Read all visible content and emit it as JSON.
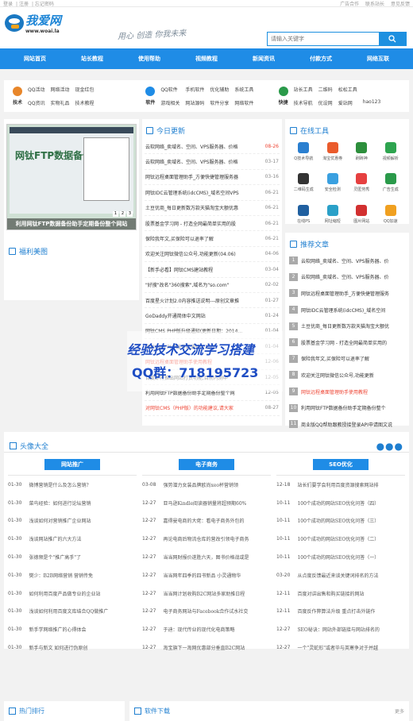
{
  "topbar": {
    "left": [
      "登录",
      "注册",
      "忘记密码"
    ],
    "right": [
      "广告合作",
      "联系站长",
      "意见反馈"
    ]
  },
  "logo": {
    "main": "我爱网",
    "sub": "www.woai.la"
  },
  "slogan": "用心 创造 你我未来",
  "search": {
    "placeholder": "请输入关键字"
  },
  "nav": [
    "网站首页",
    "站长教程",
    "使用帮助",
    "视频教程",
    "新闻资讯",
    "付款方式",
    "网络互联"
  ],
  "categories": [
    {
      "name": "技术",
      "color": "#e8862a",
      "links": [
        "QQ活动",
        "网络活动",
        "现金红包",
        "QQ资讯",
        "实物礼品",
        "技术教程"
      ]
    },
    {
      "name": "软件",
      "color": "#1f8ce6",
      "links": [
        "QQ软件",
        "手机软件",
        "优化辅助",
        "系统工具",
        "游戏相关",
        "网站源码",
        "软件分享",
        "网络软件"
      ]
    },
    {
      "name": "快捷",
      "color": "#2a9a4a",
      "links": [
        "站长工具",
        "二维码",
        "松松工具",
        "技术导航",
        "优设网",
        "爱站网",
        "优媒体",
        "唐网首页",
        "hao123"
      ]
    }
  ],
  "slider": {
    "caption": "利用网钛FTP数据备份助手定期备份整个网站",
    "big": "网钛FTP数据备份助手",
    "pages": [
      "1",
      "2",
      "3"
    ]
  },
  "sections": {
    "today": "今日更新",
    "tools": "在线工具",
    "beauty": "福利美图",
    "recommend": "推荐文章",
    "avatar": "头像大全",
    "hot": "热门排行",
    "download": "软件下载",
    "more": "更多"
  },
  "news": [
    {
      "t": "云软网络_卖域名、空间、VPS服务器、价格",
      "d": "08-26",
      "red": true
    },
    {
      "t": "云软网络_卖域名、空间、VPS服务器、价格",
      "d": "03-17"
    },
    {
      "t": "网钛远程桌面管理助手_方便快捷管理服务器",
      "d": "03-16"
    },
    {
      "t": "网钛IDC云管理系统(idcCMS)_域名空间VPS",
      "d": "06-21"
    },
    {
      "t": "土豆优商_每日更新数万款天猫淘宝大额优惠",
      "d": "06-21"
    },
    {
      "t": "股票基金学习网 - 打造全网最简单实用的股",
      "d": "06-21"
    },
    {
      "t": "保险我年文,买保险可以退率了解",
      "d": "06-21"
    },
    {
      "t": "欢迎关注网钛微信公众号,功能更新(04.06)",
      "d": "04-06"
    },
    {
      "t": "【新手必看】网钛CMS建站教程",
      "d": "03-04"
    },
    {
      "t": "\"好搜\"改名\"360搜索\",域名为\"so.com\"",
      "d": "02-02"
    },
    {
      "t": "百度星火计划2.0内容推送说明---原创文章推",
      "d": "01-27"
    },
    {
      "t": "GoDaddy开通简体中文网站",
      "d": "01-24"
    },
    {
      "t": "网钛CMS PHP版升级通知(更新日期：2014...",
      "d": "01-04"
    },
    {
      "t": "网钛CMS PHP版升级通知(V3.1)",
      "d": "01-04"
    },
    {
      "t": "网钛远程桌面管理助手使用教程",
      "d": "12-06",
      "red2": true
    },
    {
      "t": "百度即将推出网站打赏功能,目前内测中",
      "d": "12-05"
    },
    {
      "t": "利用网钛FTP数据备份助手定期备份整个网",
      "d": "12-05"
    },
    {
      "t": "对网钛CMS（PHP版）的功能建议,请大家",
      "d": "08-27",
      "red2": true
    }
  ],
  "tools": [
    {
      "n": "Q技术导航",
      "c": "#2a7fd0"
    },
    {
      "n": "淘宝优惠券",
      "c": "#ea5b2c"
    },
    {
      "n": "刷砖神",
      "c": "#2d8f3c"
    },
    {
      "n": "视频解析",
      "c": "#2ea44f"
    },
    {
      "n": "二维码生成",
      "c": "#333333"
    },
    {
      "n": "安全检测",
      "c": "#3aa0e0"
    },
    {
      "n": "灵匿劳秀",
      "c": "#e64040"
    },
    {
      "n": "广告生成",
      "c": "#2a9a4a"
    },
    {
      "n": "在线PS",
      "c": "#2060a0"
    },
    {
      "n": "网址缩短",
      "c": "#2aa0c8"
    },
    {
      "n": "图片网站",
      "c": "#d23030"
    },
    {
      "n": "QQ加速",
      "c": "#f0a020"
    }
  ],
  "recommend": [
    {
      "n": "1",
      "t": "云软网络_卖域名、空间、VPS服务器、价"
    },
    {
      "n": "2",
      "t": "云软网络_卖域名、空间、VPS服务器、价"
    },
    {
      "n": "3",
      "t": "网钛远程桌面管理助手_方便快捷管理服务"
    },
    {
      "n": "4",
      "t": "网钛IDC云管理系统(idcCMS)_域名空间"
    },
    {
      "n": "5",
      "t": "土豆优商_每日更新数万款天猫淘宝大额优"
    },
    {
      "n": "6",
      "t": "股票基金学习网 - 打造全网最简单实用的"
    },
    {
      "n": "7",
      "t": "保险我年文,买保险可以退率了解"
    },
    {
      "n": "8",
      "t": "欢迎关注网钛微信公众号,功能更新"
    },
    {
      "n": "9",
      "t": "网钛远程桌面管理助手使用教程",
      "hl": true
    },
    {
      "n": "10",
      "t": "利用网钛FTP数据备份助手定期备份整个"
    },
    {
      "n": "11",
      "t": "商业版QQ帮助跟教授接登录API申请图文说"
    }
  ],
  "watermark": {
    "line1": "经验技术交流学习搭建",
    "line2": "QQ群：718195723"
  },
  "art_cols": [
    {
      "title": "网站推广",
      "items": [
        {
          "d": "01-30",
          "t": "微博营销是什么及怎么营销?"
        },
        {
          "d": "01-30",
          "t": "菜鸟经验：如何进行论坛营销"
        },
        {
          "d": "01-30",
          "t": "浅谈如何对营销推广企业网站"
        },
        {
          "d": "01-30",
          "t": "浅谈网站推广的六大方法"
        },
        {
          "d": "01-30",
          "t": "张德频是个\"推广高手\"了"
        },
        {
          "d": "01-30",
          "t": "樊少：B2B网络营销 营销传免"
        },
        {
          "d": "01-30",
          "t": "如何利用百度产品做专业的企业站"
        },
        {
          "d": "01-30",
          "t": "浅谈如何利用百度文库结合QQ做推广"
        },
        {
          "d": "01-30",
          "t": "新手学网络推广的心得体会"
        },
        {
          "d": "01-30",
          "t": "新手与新文 如何进行伪原创"
        }
      ]
    },
    {
      "title": "电子商务",
      "items": [
        {
          "d": "03-08",
          "t": "强势潜力女装品牌欧尚xeo杯营销领"
        },
        {
          "d": "12-27",
          "t": "亚马逊Kindle阅读器销量将超预期60%"
        },
        {
          "d": "12-27",
          "t": "嘉得曼电商的大佬：看电子商务外包的"
        },
        {
          "d": "12-27",
          "t": "再论电商后物流仓库的营改引领电子商务"
        },
        {
          "d": "12-27",
          "t": "当当网财报价遂胜六天，图书价格战或是"
        },
        {
          "d": "12-27",
          "t": "当当网年四季的四书新品 小灵通物华"
        },
        {
          "d": "12-27",
          "t": "当当网计划收购B2C网站多家助推日程"
        },
        {
          "d": "12-27",
          "t": "电子商务网站与Facebook合作试水社交"
        },
        {
          "d": "12-27",
          "t": "于迪：现代传业的现代化电商策略"
        },
        {
          "d": "12-27",
          "t": "淘宝旗下一淘网优惠部分垂直B2C网站"
        }
      ]
    },
    {
      "title": "SEO优化",
      "items": [
        {
          "d": "12-18",
          "t": "站长们要学会利用百度资源搜索网站排"
        },
        {
          "d": "10-11",
          "t": "100个成功的网站SEO优化问答（四）"
        },
        {
          "d": "10-11",
          "t": "100个成功的网站SEO优化问答（三）"
        },
        {
          "d": "10-11",
          "t": "100个成功的网站SEO优化问答（二）"
        },
        {
          "d": "10-11",
          "t": "100个成功的网站SEO优化问答（一）"
        },
        {
          "d": "03-20",
          "t": "从点度反馈最近来谈关键词排名的方法"
        },
        {
          "d": "12-11",
          "t": "百度对讲出售和购买链接的网站"
        },
        {
          "d": "12-11",
          "t": "百度反作弊算法升级 重点打击外链作"
        },
        {
          "d": "12-27",
          "t": "SEO秘诀：网站外部链接与网站排名的"
        },
        {
          "d": "12-27",
          "t": "一个\"灵蛇形\"或者毕与英寒争对于并越"
        }
      ]
    }
  ]
}
